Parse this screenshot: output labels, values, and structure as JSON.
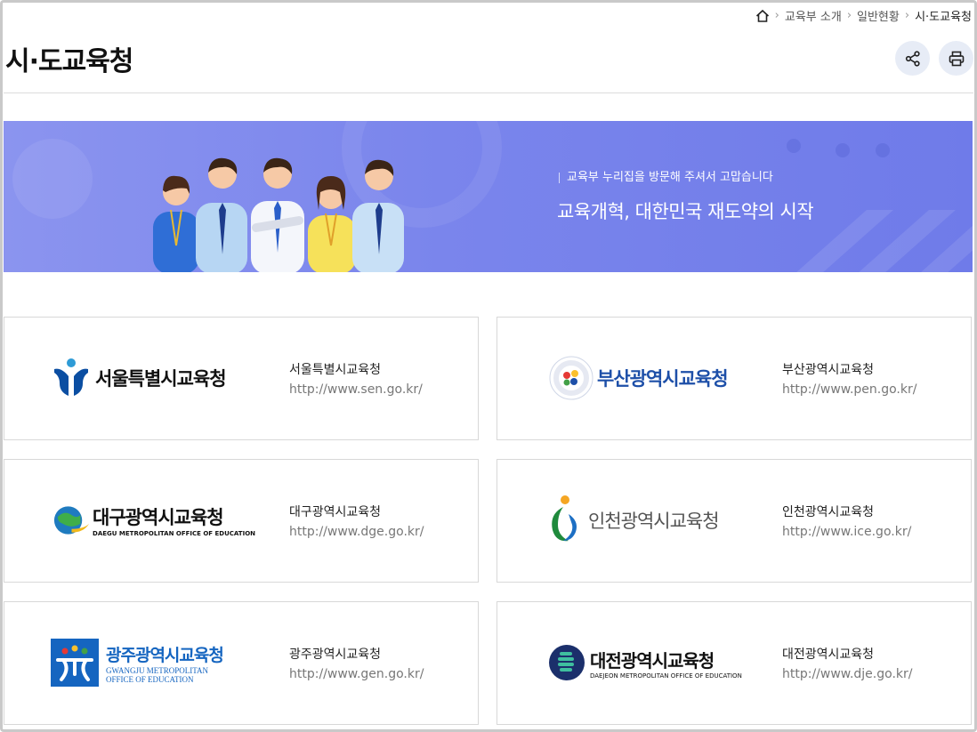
{
  "breadcrumb": {
    "items": [
      "교육부 소개",
      "일반현황"
    ],
    "current": "시·도교육청"
  },
  "page": {
    "title": "시·도교육청"
  },
  "toolbar": {
    "share_icon": "share-icon",
    "print_icon": "print-icon"
  },
  "banner": {
    "subtitle": "교육부 누리집을 방문해 주셔서 고맙습니다",
    "headline": "교육개혁, 대한민국 재도약의 시작"
  },
  "offices": [
    {
      "logo_text": "서울특별시교육청",
      "logo_sub": "",
      "name": "서울특별시교육청",
      "url": "http://www.sen.go.kr/"
    },
    {
      "logo_text": "부산광역시교육청",
      "logo_sub": "",
      "name": "부산광역시교육청",
      "url": "http://www.pen.go.kr/"
    },
    {
      "logo_text": "대구광역시교육청",
      "logo_sub": "DAEGU METROPOLITAN OFFICE OF EDUCATION",
      "name": "대구광역시교육청",
      "url": "http://www.dge.go.kr/"
    },
    {
      "logo_text": "인천광역시교육청",
      "logo_sub": "",
      "name": "인천광역시교육청",
      "url": "http://www.ice.go.kr/"
    },
    {
      "logo_text": "광주광역시교육청",
      "logo_sub": "GWANGJU METROPOLITAN",
      "logo_sub2": "OFFICE OF EDUCATION",
      "name": "광주광역시교육청",
      "url": "http://www.gen.go.kr/"
    },
    {
      "logo_text": "대전광역시교육청",
      "logo_sub": "DAEJEON METROPOLITAN OFFICE OF EDUCATION",
      "name": "대전광역시교육청",
      "url": "http://www.dje.go.kr/"
    }
  ],
  "colors": {
    "banner": "#7a85ec",
    "button_bg": "#e7ecf6",
    "seoul_blue": "#0b4ea2",
    "busan_blue": "#1d4fa8",
    "gwangju_blue": "#1565c0",
    "daejeon_navy": "#1b2f6b"
  }
}
